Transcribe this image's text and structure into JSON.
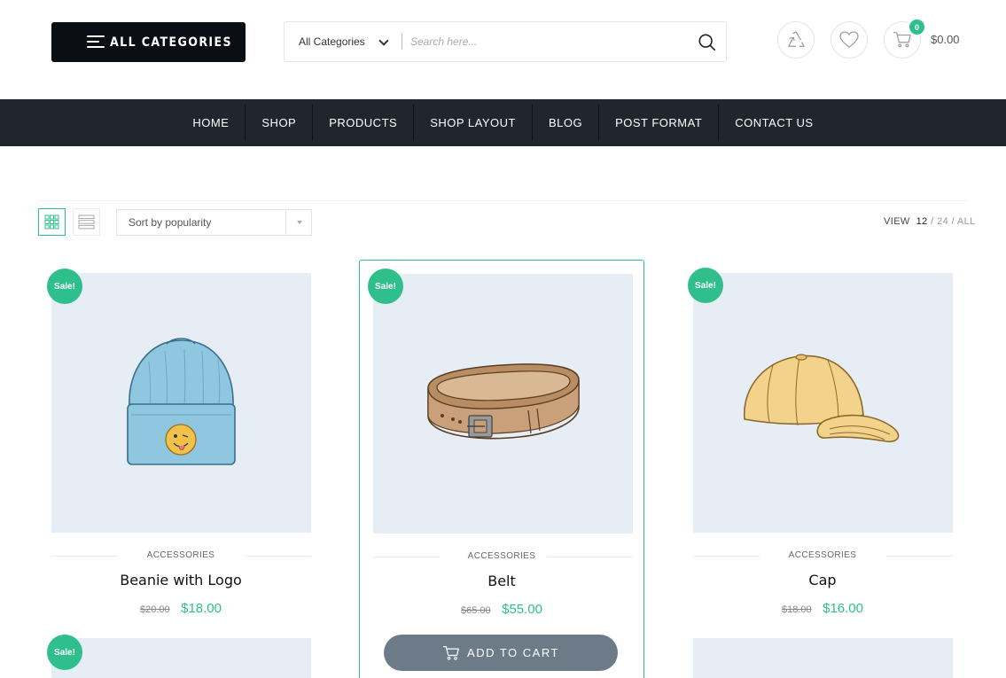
{
  "header": {
    "categories_button": "ALL CATEGORIES",
    "search": {
      "category": "All Categories",
      "placeholder": "Search here..."
    },
    "cart": {
      "count": "0",
      "total": "$0.00"
    }
  },
  "nav": {
    "items": [
      "HOME",
      "SHOP",
      "PRODUCTS",
      "SHOP LAYOUT",
      "BLOG",
      "POST FORMAT",
      "CONTACT US"
    ]
  },
  "toolbar": {
    "sort": "Sort by popularity",
    "view_label": "VIEW",
    "view_options": [
      "12",
      "24",
      "ALL"
    ]
  },
  "products": [
    {
      "sale": "Sale!",
      "category": "ACCESSORIES",
      "name": "Beanie with Logo",
      "old_price": "$20.00",
      "price": "$18.00"
    },
    {
      "sale": "Sale!",
      "category": "ACCESSORIES",
      "name": "Belt",
      "old_price": "$65.00",
      "price": "$55.00",
      "add_to_cart": "ADD TO CART"
    },
    {
      "sale": "Sale!",
      "category": "ACCESSORIES",
      "name": "Cap",
      "old_price": "$18.00",
      "price": "$16.00"
    }
  ],
  "row2": {
    "sale": "Sale!"
  },
  "colors": {
    "accent": "#2fbf8c",
    "nav_bg": "#1f262e",
    "button_dark": "#0b0e14",
    "image_bg": "#e7edf4",
    "cart_button": "#6d7b88"
  },
  "icons": [
    "menu-icon",
    "chevron-down-icon",
    "search-icon",
    "recycle-icon",
    "heart-icon",
    "cart-icon",
    "grid-view-icon",
    "list-view-icon"
  ]
}
